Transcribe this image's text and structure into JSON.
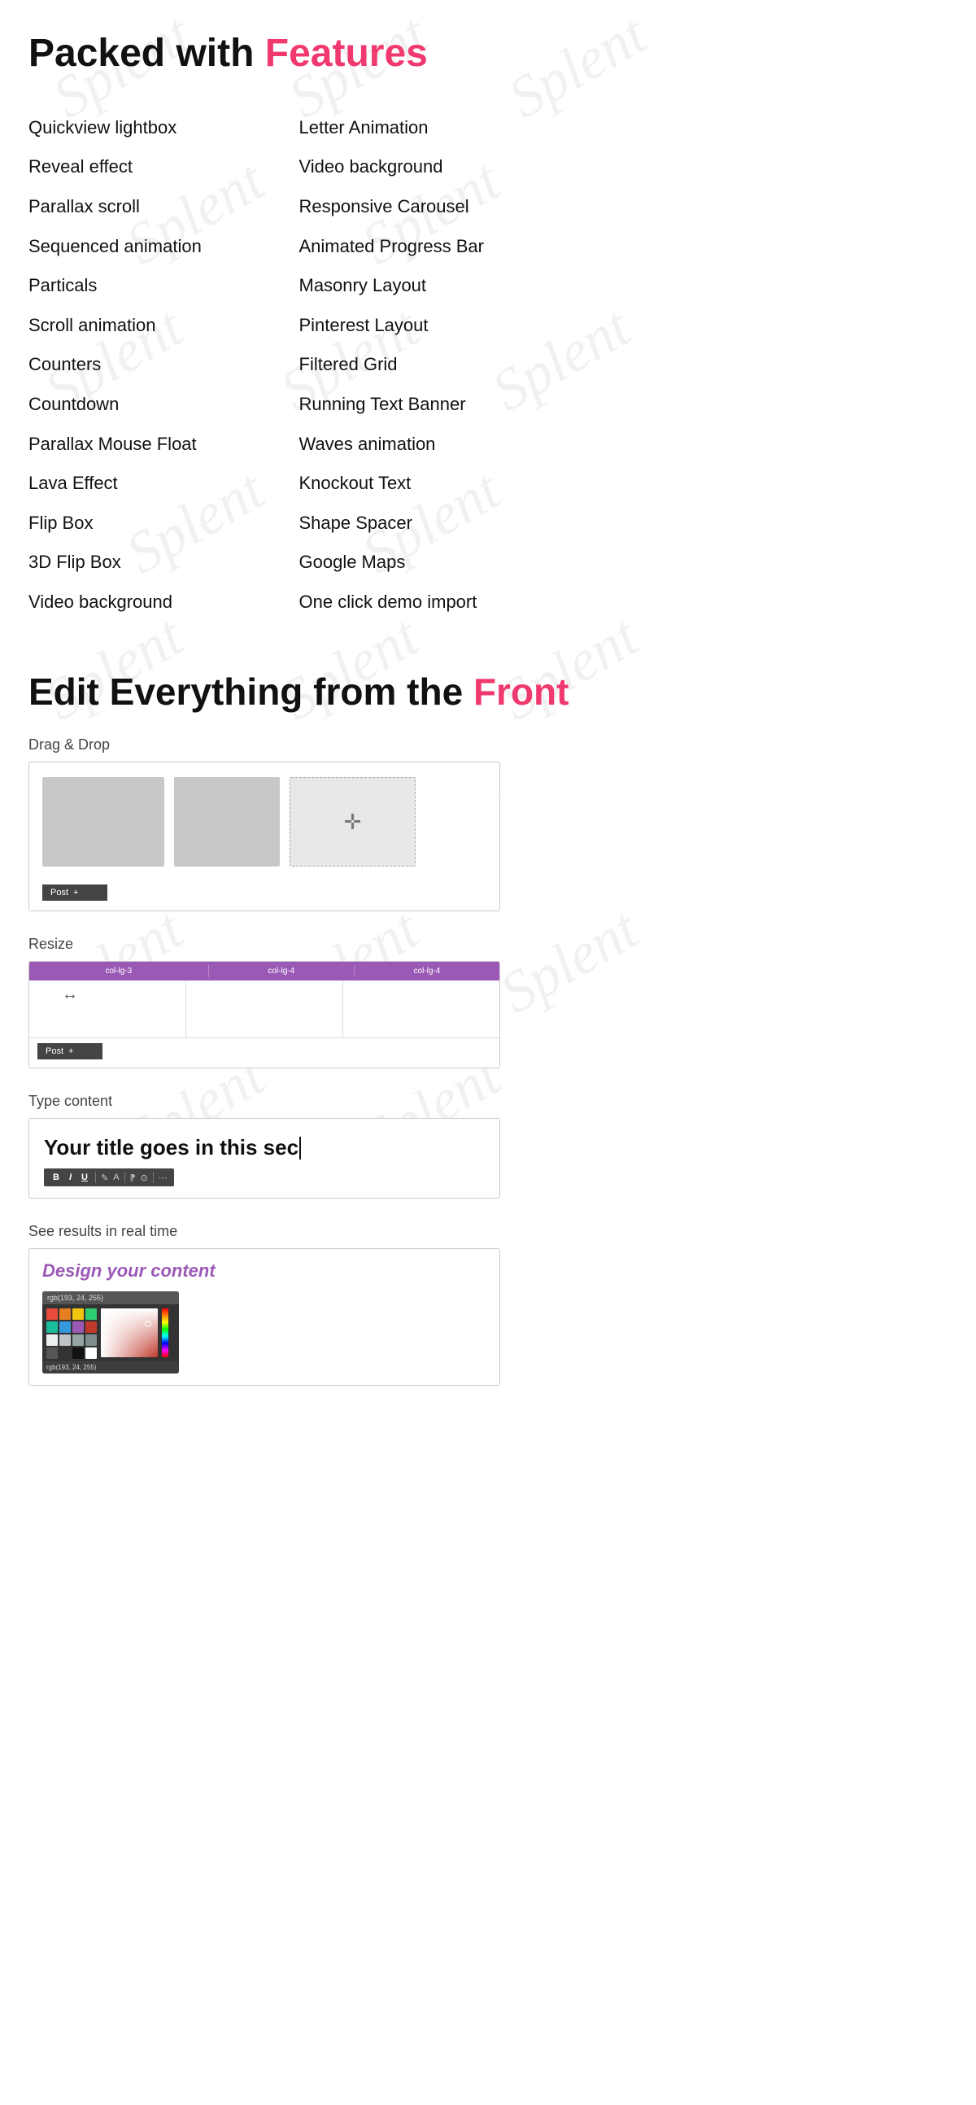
{
  "watermarks": [
    "Splent",
    "Splent",
    "Splent",
    "Splent",
    "Splent",
    "Splent",
    "Splent",
    "Splent",
    "Splent",
    "Splent",
    "Splent",
    "Splent"
  ],
  "section1": {
    "title_plain": "Packed with ",
    "title_highlight": "Features",
    "features_left": [
      "Quickview lightbox",
      "Reveal effect",
      "Parallax scroll",
      "Sequenced animation",
      "Particals",
      "Scroll animation",
      "Counters",
      "Countdown",
      "Parallax Mouse Float",
      "Lava Effect",
      "Flip Box",
      "3D Flip Box",
      "Video background"
    ],
    "features_right": [
      "Letter Animation",
      "Video background",
      "Responsive Carousel",
      "Animated Progress Bar",
      "Masonry Layout",
      "Pinterest Layout",
      "Filtered Grid",
      "Running Text Banner",
      "Waves animation",
      "Knockout Text",
      "Shape Spacer",
      "Google Maps",
      "One click demo import"
    ]
  },
  "section2": {
    "title_plain": "Edit Everything from the ",
    "title_highlight": "Front",
    "demos": [
      {
        "label": "Drag & Drop",
        "type": "drag-drop"
      },
      {
        "label": "Resize",
        "type": "resize",
        "cols": [
          "col-lg-3",
          "col-lg-4",
          "col-lg-4"
        ]
      },
      {
        "label": "Type content",
        "type": "type-content",
        "title": "Your title goes in this sec"
      },
      {
        "label": "See results in real time",
        "type": "realtime",
        "design_label": "Design your content",
        "color_picker_top": "rgb(193, 24, 255)",
        "color_picker_bottom": "rgb(193, 24, 255)"
      }
    ],
    "post_label": "Post",
    "resize_arrow": "↔",
    "move_icon": "✛"
  }
}
